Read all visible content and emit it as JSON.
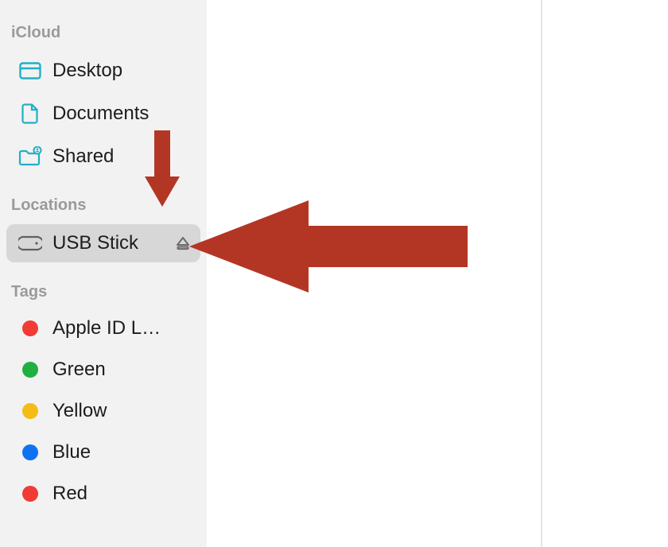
{
  "colors": {
    "accent": "#1fb0c5",
    "arrow": "#b33625",
    "tag_red": "#f13b36",
    "tag_green": "#1fb041",
    "tag_yellow": "#f4bc17",
    "tag_blue": "#0f72f2"
  },
  "sections": {
    "icloud": {
      "title": "iCloud",
      "items": [
        {
          "id": "desktop",
          "label": "Desktop",
          "icon": "desktop"
        },
        {
          "id": "documents",
          "label": "Documents",
          "icon": "document"
        },
        {
          "id": "shared",
          "label": "Shared",
          "icon": "shared-folder"
        }
      ]
    },
    "locations": {
      "title": "Locations",
      "items": [
        {
          "id": "usb-stick",
          "label": "USB Stick",
          "icon": "external-drive",
          "ejectable": true,
          "selected": true
        }
      ]
    },
    "tags": {
      "title": "Tags",
      "items": [
        {
          "id": "apple-id",
          "label": "Apple ID L…",
          "colorKey": "tag_red"
        },
        {
          "id": "green",
          "label": "Green",
          "colorKey": "tag_green"
        },
        {
          "id": "yellow",
          "label": "Yellow",
          "colorKey": "tag_yellow"
        },
        {
          "id": "blue",
          "label": "Blue",
          "colorKey": "tag_blue"
        },
        {
          "id": "red",
          "label": "Red",
          "colorKey": "tag_red"
        }
      ]
    }
  }
}
